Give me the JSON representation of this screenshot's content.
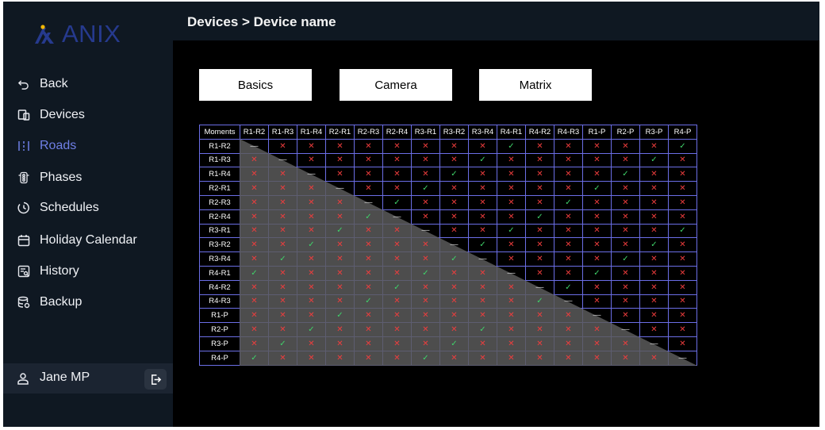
{
  "brand": {
    "name": "ANIX",
    "accent_color": "#263a8e",
    "mark_color": "#f2b705"
  },
  "breadcrumb": "Devices > Device name",
  "sidebar": {
    "items": [
      {
        "label": "Back",
        "icon": "back-arrow-icon"
      },
      {
        "label": "Devices",
        "icon": "devices-icon"
      },
      {
        "label": "Roads",
        "icon": "roads-icon",
        "active": true
      },
      {
        "label": "Phases",
        "icon": "phases-icon"
      },
      {
        "label": "Schedules",
        "icon": "clock-icon"
      },
      {
        "label": "Holiday Calendar",
        "icon": "calendar-icon"
      },
      {
        "label": "History",
        "icon": "history-icon"
      },
      {
        "label": "Backup",
        "icon": "backup-icon"
      }
    ],
    "user": {
      "name": "Jane MP",
      "icon": "user-icon",
      "logout_icon": "logout-icon"
    }
  },
  "tabs": [
    {
      "label": "Basics"
    },
    {
      "label": "Camera"
    },
    {
      "label": "Matrix"
    }
  ],
  "matrix": {
    "corner_label": "Moments",
    "columns": [
      "R1-R2",
      "R1-R3",
      "R1-R4",
      "R2-R1",
      "R2-R3",
      "R2-R4",
      "R3-R1",
      "R3-R2",
      "R3-R4",
      "R4-R1",
      "R4-R2",
      "R4-R3",
      "R1-P",
      "R2-P",
      "R3-P",
      "R4-P"
    ],
    "rows": [
      {
        "label": "R1-R2",
        "cells": "-xxxxxxxxvxxxxxv"
      },
      {
        "label": "R1-R3",
        "cells": "x-xxxxxxvxxxxxvx"
      },
      {
        "label": "R1-R4",
        "cells": "xx-xxxxvxxxxxvxx"
      },
      {
        "label": "R2-R1",
        "cells": "xxx-xxvxxxxxvxxx"
      },
      {
        "label": "R2-R3",
        "cells": "xxxx-vxxxxxvxxxx"
      },
      {
        "label": "R2-R4",
        "cells": "xxxxv-xxxxvxxxxx"
      },
      {
        "label": "R3-R1",
        "cells": "xxxvxx-xxvxxxxxv"
      },
      {
        "label": "R3-R2",
        "cells": "xxvxxxx-vxxxxxvx"
      },
      {
        "label": "R3-R4",
        "cells": "xvxxxxxv-xxxxvxx"
      },
      {
        "label": "R4-R1",
        "cells": "vxxxxxvxx-xxvxxx"
      },
      {
        "label": "R4-R2",
        "cells": "xxxxxvxxxx-vxxxx"
      },
      {
        "label": "R4-R3",
        "cells": "xxxxvxxxxxv-xxxx"
      },
      {
        "label": "R1-P",
        "cells": "xxxvxxxxxxxx-xxx"
      },
      {
        "label": "R2-P",
        "cells": "xxvxxxxxvxxxx-xx"
      },
      {
        "label": "R3-P",
        "cells": "xvxxxxxvxxxxxx-x"
      },
      {
        "label": "R4-P",
        "cells": "vxxxxxvxxxxxxxx-"
      }
    ],
    "symbols": {
      "x": "✕",
      "v": "✓",
      "-": "—"
    },
    "colors": {
      "grid": "#6b6ee6",
      "blocked": "#ef3d3d",
      "allowed": "#3fd36a",
      "shade": "#5a5a5a"
    }
  }
}
